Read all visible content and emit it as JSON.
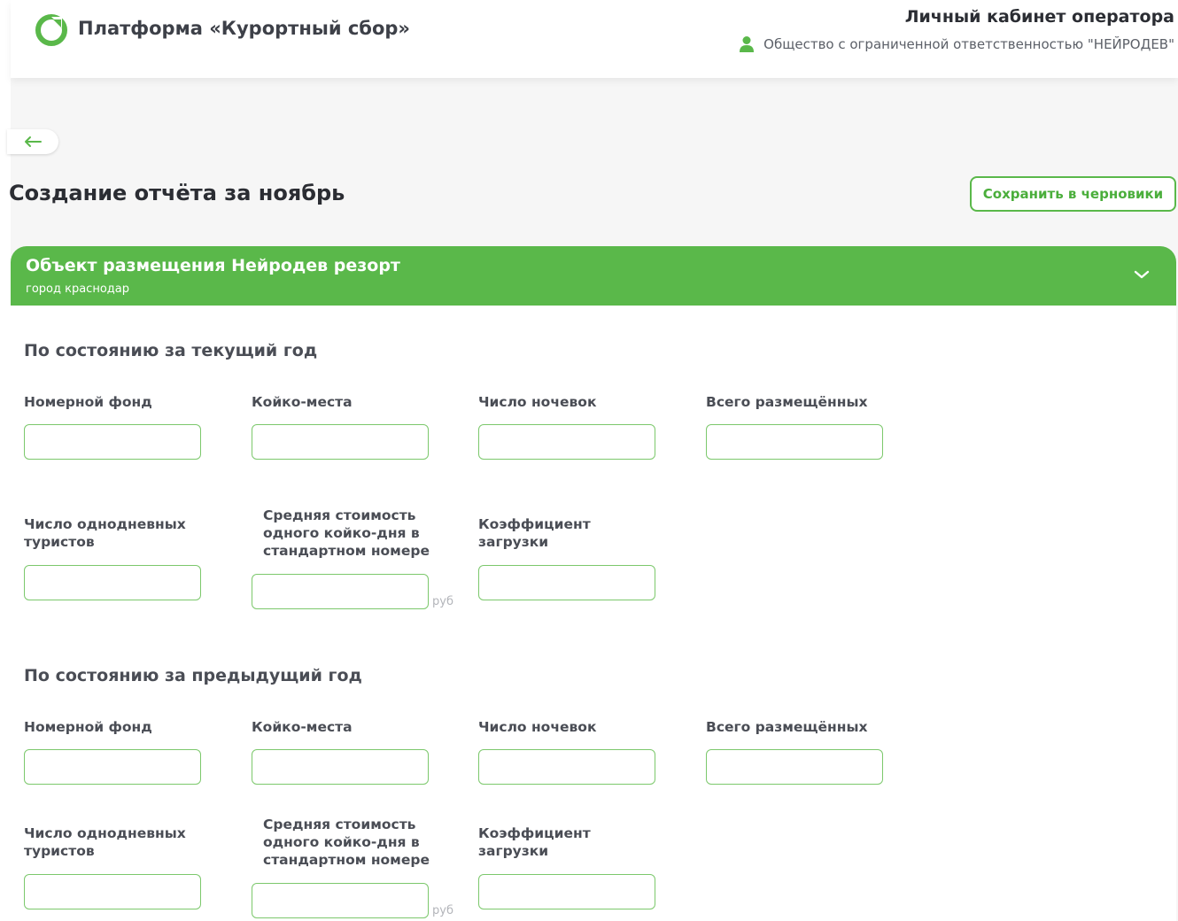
{
  "header": {
    "brand_title": "Платформа «Курортный сбор»",
    "cabinet_title": "Личный кабинет оператора",
    "organization": "Общество с ограниченной ответственностью  \"НЕЙРОДЕВ\""
  },
  "page": {
    "title": "Создание отчёта за ноябрь",
    "save_draft_label": "Сохранить в черновики"
  },
  "object": {
    "title": "Объект размещения Нейродев резорт",
    "subtitle": "город краснодар"
  },
  "sections": {
    "current": {
      "title": "По состоянию за текущий год",
      "fields": {
        "room_fund": {
          "label": "Номерной фонд",
          "value": ""
        },
        "beds": {
          "label": "Койко-места",
          "value": ""
        },
        "nights": {
          "label": "Число ночевок",
          "value": ""
        },
        "total_placed": {
          "label": "Всего размещённых",
          "value": ""
        },
        "day_tourists": {
          "label": "Число однодневных туристов",
          "value": ""
        },
        "avg_cost": {
          "label": "Средняя стоимость одного койко-дня в стандартном номере",
          "value": "",
          "unit": "руб"
        },
        "load_factor": {
          "label": "Коэффициент загрузки",
          "value": ""
        }
      }
    },
    "previous": {
      "title": "По состоянию за предыдущий год",
      "fields": {
        "room_fund": {
          "label": "Номерной фонд",
          "value": ""
        },
        "beds": {
          "label": "Койко-места",
          "value": ""
        },
        "nights": {
          "label": "Число ночевок",
          "value": ""
        },
        "total_placed": {
          "label": "Всего размещённых",
          "value": ""
        },
        "day_tourists": {
          "label": "Число однодневных туристов",
          "value": ""
        },
        "avg_cost": {
          "label": "Средняя стоимость одного койко-дня в стандартном номере",
          "value": "",
          "unit": "руб"
        },
        "load_factor": {
          "label": "Коэффициент загрузки",
          "value": ""
        }
      }
    }
  },
  "icons": {
    "logo": "logo-icon",
    "user": "user-icon",
    "back": "arrow-left-icon",
    "collapse": "chevron-down-icon"
  },
  "colors": {
    "accent": "#5ab84a",
    "input_border": "#7cc86c",
    "text": "#3d4048",
    "page_bg": "#f6f6f6"
  }
}
